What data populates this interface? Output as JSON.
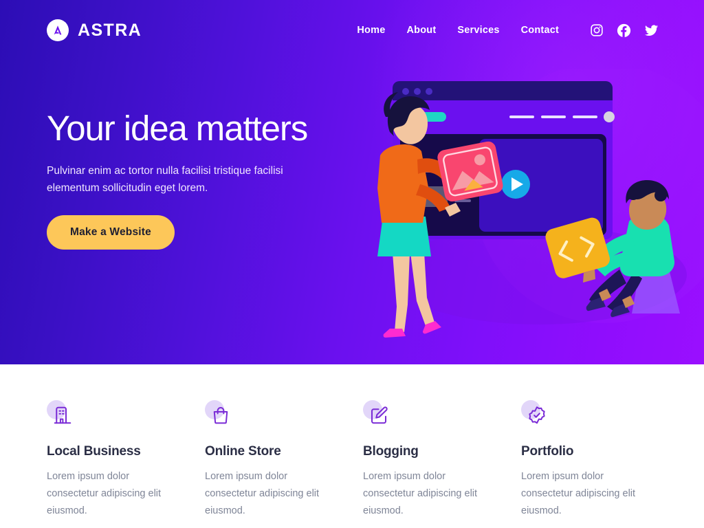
{
  "colors": {
    "hero_gradient_start": "#2c0db5",
    "hero_gradient_end": "#9a0fff",
    "cta_background": "#fdc759",
    "cta_text": "#202032",
    "feature_icon": "#7a2bd6",
    "feature_blob": "#e2d6f9",
    "feature_title": "#2b2e45",
    "feature_text": "#7f8597",
    "page_background": "#ffffff"
  },
  "header": {
    "brand": {
      "name": "ASTRA",
      "mark_icon": "astra-logo-icon"
    },
    "nav": [
      {
        "label": "Home"
      },
      {
        "label": "About"
      },
      {
        "label": "Services"
      },
      {
        "label": "Contact"
      }
    ],
    "social": [
      {
        "name": "instagram-icon",
        "label": "Instagram"
      },
      {
        "name": "facebook-icon",
        "label": "Facebook"
      },
      {
        "name": "twitter-icon",
        "label": "Twitter"
      }
    ]
  },
  "hero": {
    "title": "Your idea matters",
    "subtitle": "Pulvinar enim ac tortor nulla facilisi tristique facilisi elementum sollicitudin eget lorem.",
    "cta_label": "Make a Website",
    "illustration": {
      "name": "team-building-website-illustration",
      "elements": [
        "browser-window-mockup",
        "video-play-button",
        "woman-holding-image-card",
        "man-holding-code-card"
      ]
    }
  },
  "features": [
    {
      "icon": "building-icon",
      "title": "Local Business",
      "text": "Lorem ipsum dolor consectetur adipiscing elit eiusmod."
    },
    {
      "icon": "shopping-bag-icon",
      "title": "Online Store",
      "text": "Lorem ipsum dolor consectetur adipiscing elit eiusmod."
    },
    {
      "icon": "edit-pencil-icon",
      "title": "Blogging",
      "text": "Lorem ipsum dolor consectetur adipiscing elit eiusmod."
    },
    {
      "icon": "verified-badge-icon",
      "title": "Portfolio",
      "text": "Lorem ipsum dolor consectetur adipiscing elit eiusmod."
    }
  ]
}
